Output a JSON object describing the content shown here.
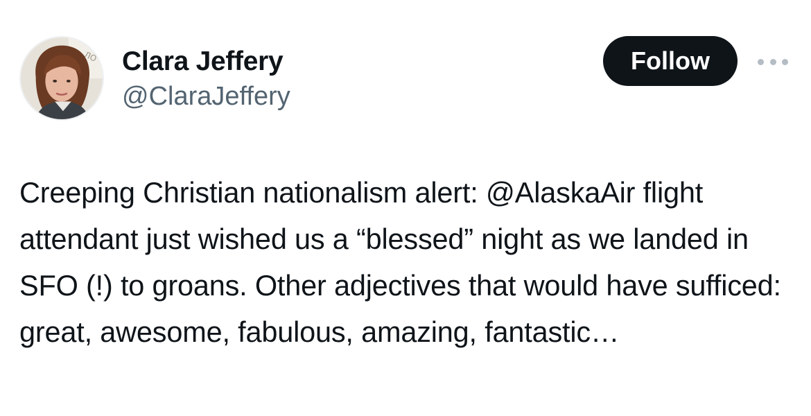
{
  "author": {
    "display_name": "Clara Jeffery",
    "handle": "@ClaraJeffery",
    "avatar_icon": "profile-photo"
  },
  "actions": {
    "follow_label": "Follow",
    "more_icon": "ellipsis-icon"
  },
  "tweet": {
    "text": "Creeping Christian nationalism alert: @AlaskaAir flight attendant just wished us a “blessed” night as we landed in SFO (!) to groans. Other adjectives that would have sufficed: great, awesome, fabulous, amazing, fantastic…"
  },
  "colors": {
    "text_primary": "#0f1419",
    "text_secondary": "#536471",
    "button_bg": "#0f1419",
    "button_text": "#ffffff"
  }
}
